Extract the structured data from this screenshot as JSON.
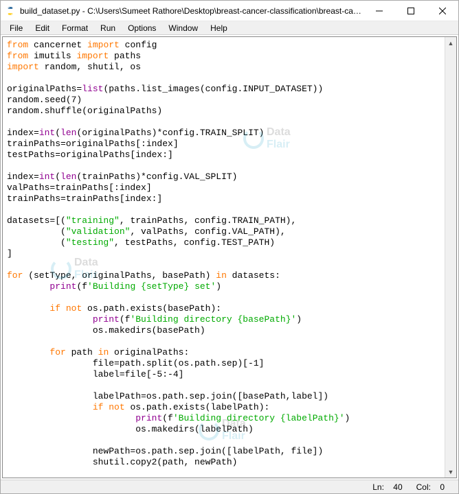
{
  "window": {
    "title": "build_dataset.py - C:\\Users\\Sumeet Rathore\\Desktop\\breast-cancer-classification\\breast-can..."
  },
  "menu": {
    "items": [
      "File",
      "Edit",
      "Format",
      "Run",
      "Options",
      "Window",
      "Help"
    ]
  },
  "watermark": {
    "text1": "Data",
    "text2": "Flair"
  },
  "status": {
    "ln_label": "Ln:",
    "ln_value": "40",
    "col_label": "Col:",
    "col_value": "0"
  },
  "code": {
    "l1": {
      "a": "from",
      "b": " cancernet ",
      "c": "import",
      "d": " config"
    },
    "l2": {
      "a": "from",
      "b": " imutils ",
      "c": "import",
      "d": " paths"
    },
    "l3": {
      "a": "import",
      "b": " random, shutil, os"
    },
    "l4": "",
    "l5": {
      "a": "originalPaths=",
      "b": "list",
      "c": "(paths.list_images(config.INPUT_DATASET))"
    },
    "l6": "random.seed(7)",
    "l7": "random.shuffle(originalPaths)",
    "l8": "",
    "l9": {
      "a": "index=",
      "b": "int",
      "c": "(",
      "d": "len",
      "e": "(originalPaths)*config.TRAIN_SPLIT)"
    },
    "l10": "trainPaths=originalPaths[:index]",
    "l11": "testPaths=originalPaths[index:]",
    "l12": "",
    "l13": {
      "a": "index=",
      "b": "int",
      "c": "(",
      "d": "len",
      "e": "(trainPaths)*config.VAL_SPLIT)"
    },
    "l14": "valPaths=trainPaths[:index]",
    "l15": "trainPaths=trainPaths[index:]",
    "l16": "",
    "l17": {
      "a": "datasets=[(",
      "b": "\"training\"",
      "c": ", trainPaths, config.TRAIN_PATH),"
    },
    "l18": {
      "a": "          (",
      "b": "\"validation\"",
      "c": ", valPaths, config.VAL_PATH),"
    },
    "l19": {
      "a": "          (",
      "b": "\"testing\"",
      "c": ", testPaths, config.TEST_PATH)"
    },
    "l20": "]",
    "l21": "",
    "l22": {
      "a": "for",
      "b": " (setType, originalPaths, basePath) ",
      "c": "in",
      "d": " datasets:"
    },
    "l23": {
      "a": "        ",
      "b": "print",
      "c": "(f",
      "d": "'Building {setType} set'",
      "e": ")"
    },
    "l24": "",
    "l25": {
      "a": "        ",
      "b": "if",
      "c": " ",
      "d": "not",
      "e": " os.path.exists(basePath):"
    },
    "l26": {
      "a": "                ",
      "b": "print",
      "c": "(f",
      "d": "'Building directory {basePath}'",
      "e": ")"
    },
    "l27": "                os.makedirs(basePath)",
    "l28": "",
    "l29": {
      "a": "        ",
      "b": "for",
      "c": " path ",
      "d": "in",
      "e": " originalPaths:"
    },
    "l30": "                file=path.split(os.path.sep)[-1]",
    "l31": "                label=file[-5:-4]",
    "l32": "",
    "l33": "                labelPath=os.path.sep.join([basePath,label])",
    "l34": {
      "a": "                ",
      "b": "if",
      "c": " ",
      "d": "not",
      "e": " os.path.exists(labelPath):"
    },
    "l35": {
      "a": "                        ",
      "b": "print",
      "c": "(f",
      "d": "'Building directory {labelPath}'",
      "e": ")"
    },
    "l36": "                        os.makedirs(labelPath)",
    "l37": "",
    "l38": "                newPath=os.path.sep.join([labelPath, file])",
    "l39": "                shutil.copy2(path, newPath)"
  }
}
